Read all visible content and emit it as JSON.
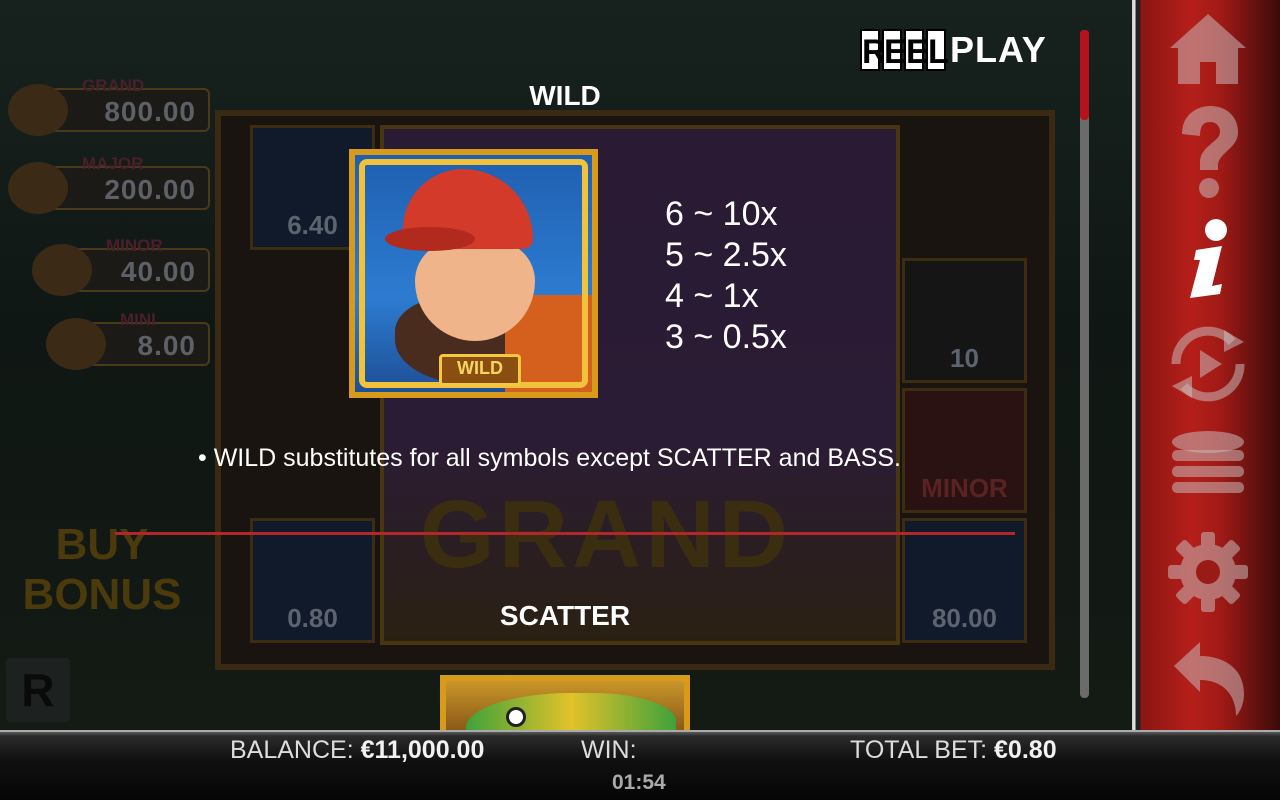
{
  "logo": {
    "reel": [
      "R",
      "E",
      "E",
      "L"
    ],
    "play": "PLAY"
  },
  "background": {
    "jackpots": [
      {
        "label": "GRAND",
        "value": "800.00"
      },
      {
        "label": "MAJOR",
        "value": "200.00"
      },
      {
        "label": "MINOR",
        "value": "40.00"
      },
      {
        "label": "MINI",
        "value": "8.00"
      }
    ],
    "cells": [
      "6.40",
      "0.80",
      "10",
      "MINOR",
      "80.00"
    ],
    "grand_text": "GRAND",
    "buy_bonus": "BUY BONUS",
    "r_badge": "R"
  },
  "info": {
    "wild_title": "WILD",
    "wild_badge": "WILD",
    "paytable": [
      "6 ~ 10x",
      "5 ~ 2.5x",
      "4 ~ 1x",
      "3 ~ 0.5x"
    ],
    "wild_rule": "• WILD substitutes for all symbols except SCATTER and BASS.",
    "scatter_title": "SCATTER"
  },
  "scroll": {
    "position_fraction": 0.0
  },
  "sidebar": {
    "icons": [
      "home-icon",
      "help-icon",
      "info-icon",
      "autoplay-icon",
      "bet-coins-icon",
      "settings-icon",
      "back-icon"
    ],
    "active": "info-icon"
  },
  "bottom": {
    "balance_label": "BALANCE:",
    "balance_value": "€11,000.00",
    "win_label": "WIN:",
    "win_value": "",
    "total_bet_label": "TOTAL BET:",
    "total_bet_value": "€0.80",
    "clock": "01:54"
  },
  "colors": {
    "accent_red": "#b3262a",
    "gold": "#d89a1a",
    "sidebar_red": "#b51f1a"
  }
}
